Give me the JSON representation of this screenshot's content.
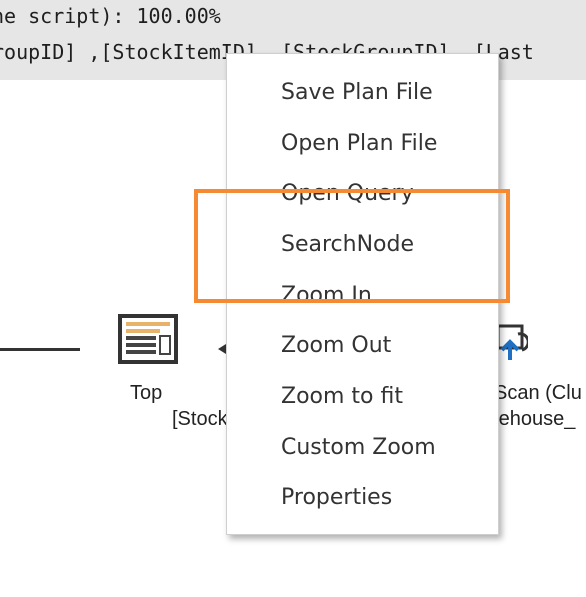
{
  "query_header": {
    "line1": "ne script): 100.00%",
    "line2": "roupID] ,[StockItemID] ,[StockGroupID] ,[Last"
  },
  "plan": {
    "top_node_label": "Top",
    "top_node_sub": "[Stock",
    "scan_node_label": "Scan (Clu",
    "scan_node_sub": "rehouse_"
  },
  "context_menu": {
    "items": [
      {
        "label": "Save Plan File"
      },
      {
        "label": "Open Plan File"
      },
      {
        "label": "Open Query"
      },
      {
        "label": "SearchNode"
      },
      {
        "label": "Zoom In"
      },
      {
        "label": "Zoom Out"
      },
      {
        "label": "Zoom to fit"
      },
      {
        "label": "Custom Zoom"
      },
      {
        "label": "Properties"
      }
    ]
  },
  "colors": {
    "highlight": "#f58a32",
    "header_bg": "#e6e6e6",
    "icon_accent": "#1f6fc2"
  },
  "icons": {
    "top_node": "table-top-icon",
    "scan_node": "index-scan-icon"
  }
}
